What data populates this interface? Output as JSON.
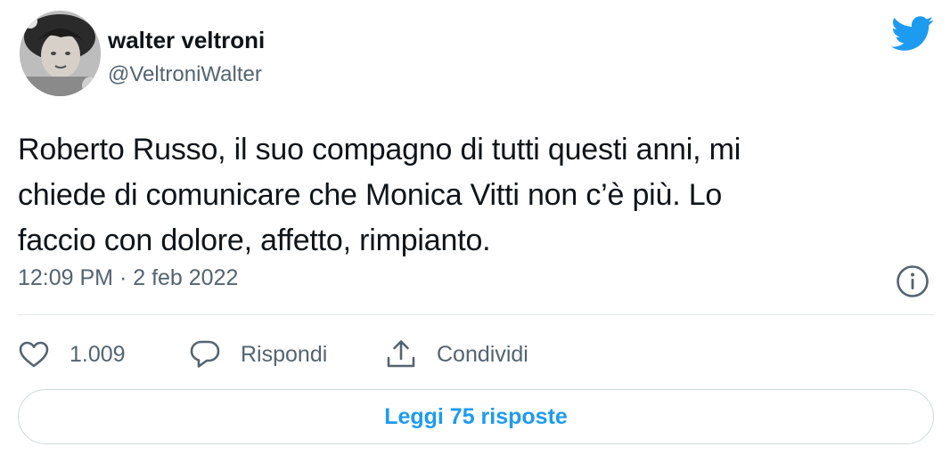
{
  "user": {
    "name": "walter veltroni",
    "handle": "@VeltroniWalter"
  },
  "tweet": {
    "lines": [
      "Roberto Russo, il suo compagno di tutti questi anni, mi",
      "chiede di comunicare che Monica Vitti non c’è più. Lo",
      "faccio con dolore, affetto, rimpianto."
    ],
    "timestamp": "12:09 PM · 2 feb 2022"
  },
  "actions": {
    "like_count": "1.009",
    "reply_label": "Rispondi",
    "share_label": "Condividi"
  },
  "replies_button": "Leggi 75 risposte",
  "colors": {
    "brand": "#1d9bf0",
    "text": "#0f1419",
    "muted": "#536471",
    "border": "#cfd9de"
  },
  "icons": [
    "avatar",
    "twitter-bird-icon",
    "info-icon",
    "heart-icon",
    "reply-bubble-icon",
    "share-icon"
  ]
}
